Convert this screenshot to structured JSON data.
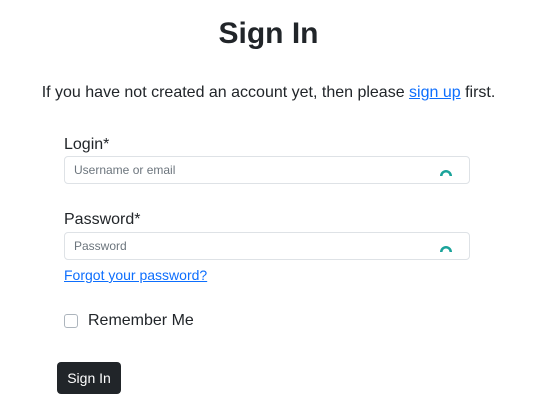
{
  "page": {
    "title": "Sign In",
    "intro_before": "If you have not created an account yet, then please ",
    "intro_link": "sign up",
    "intro_after": " first."
  },
  "form": {
    "login_label": "Login*",
    "login_placeholder": "Username or email",
    "login_value": "",
    "password_label": "Password*",
    "password_placeholder": "Password",
    "password_value": "",
    "forgot_link": "Forgot your password?",
    "remember_label": "Remember Me",
    "remember_checked": false,
    "submit_label": "Sign In"
  },
  "icons": {
    "password_manager": "password-manager-icon"
  },
  "colors": {
    "link": "#0d6efd",
    "button_bg": "#212529",
    "icon_teal": "#1aa39a"
  }
}
